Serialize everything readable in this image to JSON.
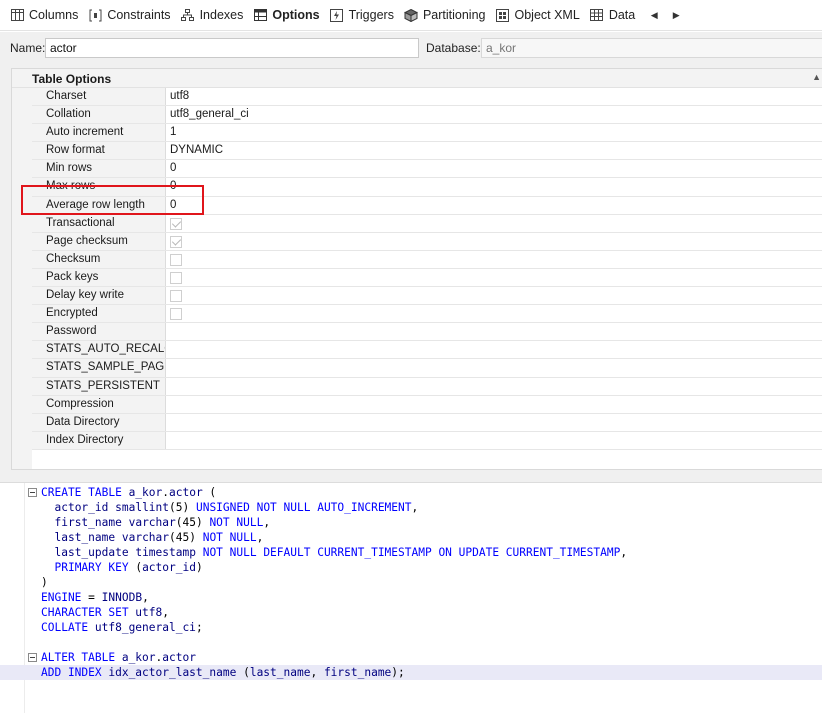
{
  "tabs": [
    {
      "label": "Columns",
      "icon": "columns-icon",
      "active": false
    },
    {
      "label": "Constraints",
      "icon": "constraints-icon",
      "active": false
    },
    {
      "label": "Indexes",
      "icon": "indexes-icon",
      "active": false
    },
    {
      "label": "Options",
      "icon": "options-icon",
      "active": true
    },
    {
      "label": "Triggers",
      "icon": "triggers-icon",
      "active": false
    },
    {
      "label": "Partitioning",
      "icon": "partitioning-icon",
      "active": false
    },
    {
      "label": "Object XML",
      "icon": "object-xml-icon",
      "active": false
    },
    {
      "label": "Data",
      "icon": "data-icon",
      "active": false
    }
  ],
  "nav": {
    "prev": "◀",
    "next": "▶"
  },
  "name_row": {
    "name_label": "Name:",
    "name_value": "actor",
    "database_label": "Database:",
    "database_placeholder": "a_kor"
  },
  "options": {
    "title": "Table Options",
    "collapse_glyph": "▲",
    "rows": [
      {
        "key": "Charset",
        "value": "utf8"
      },
      {
        "key": "Collation",
        "value": "utf8_general_ci"
      },
      {
        "key": "Auto increment",
        "value": "1"
      },
      {
        "key": "Row format",
        "value": "DYNAMIC"
      },
      {
        "key": "Min rows",
        "value": "0"
      },
      {
        "key": "Max rows",
        "value": "0"
      },
      {
        "key": "Average row length",
        "value": "0"
      },
      {
        "key": "Transactional",
        "checkbox": true,
        "checked": true
      },
      {
        "key": "Page checksum",
        "checkbox": true,
        "checked": true
      },
      {
        "key": "Checksum",
        "checkbox": true,
        "checked": false
      },
      {
        "key": "Pack keys",
        "checkbox": true,
        "checked": false
      },
      {
        "key": "Delay key write",
        "checkbox": true,
        "checked": false
      },
      {
        "key": "Encrypted",
        "checkbox": true,
        "checked": false
      },
      {
        "key": "Password",
        "value": ""
      },
      {
        "key": "STATS_AUTO_RECALC",
        "value": ""
      },
      {
        "key": "STATS_SAMPLE_PAGES",
        "value": ""
      },
      {
        "key": "STATS_PERSISTENT",
        "value": ""
      },
      {
        "key": "Compression",
        "value": ""
      },
      {
        "key": "Data Directory",
        "value": ""
      },
      {
        "key": "Index Directory",
        "value": ""
      }
    ]
  },
  "sql": [
    {
      "fold": true,
      "tokens": [
        [
          "kw",
          "CREATE TABLE "
        ],
        [
          "nm",
          "a_kor"
        ],
        [
          "pl",
          "."
        ],
        [
          "nm",
          "actor"
        ],
        [
          "pl",
          " ("
        ]
      ]
    },
    {
      "tokens": [
        [
          "pl",
          "  "
        ],
        [
          "nm",
          "actor_id"
        ],
        [
          "pl",
          " "
        ],
        [
          "ty",
          "smallint"
        ],
        [
          "pl",
          "(5) "
        ],
        [
          "kw",
          "UNSIGNED NOT NULL AUTO_INCREMENT"
        ],
        [
          "pl",
          ","
        ]
      ]
    },
    {
      "tokens": [
        [
          "pl",
          "  "
        ],
        [
          "nm",
          "first_name"
        ],
        [
          "pl",
          " "
        ],
        [
          "ty",
          "varchar"
        ],
        [
          "pl",
          "(45) "
        ],
        [
          "kw",
          "NOT NULL"
        ],
        [
          "pl",
          ","
        ]
      ]
    },
    {
      "tokens": [
        [
          "pl",
          "  "
        ],
        [
          "nm",
          "last_name"
        ],
        [
          "pl",
          " "
        ],
        [
          "ty",
          "varchar"
        ],
        [
          "pl",
          "(45) "
        ],
        [
          "kw",
          "NOT NULL"
        ],
        [
          "pl",
          ","
        ]
      ]
    },
    {
      "tokens": [
        [
          "pl",
          "  "
        ],
        [
          "nm",
          "last_update"
        ],
        [
          "pl",
          " "
        ],
        [
          "ty",
          "timestamp"
        ],
        [
          "pl",
          " "
        ],
        [
          "kw",
          "NOT NULL DEFAULT CURRENT_TIMESTAMP ON UPDATE CURRENT_TIMESTAMP"
        ],
        [
          "pl",
          ","
        ]
      ]
    },
    {
      "tokens": [
        [
          "pl",
          "  "
        ],
        [
          "kw",
          "PRIMARY KEY"
        ],
        [
          "pl",
          " ("
        ],
        [
          "nm",
          "actor_id"
        ],
        [
          "pl",
          ")"
        ]
      ]
    },
    {
      "tokens": [
        [
          "pl",
          ")"
        ]
      ]
    },
    {
      "tokens": [
        [
          "kw",
          "ENGINE"
        ],
        [
          "pl",
          " = "
        ],
        [
          "nm",
          "INNODB"
        ],
        [
          "pl",
          ","
        ]
      ]
    },
    {
      "tokens": [
        [
          "kw",
          "CHARACTER SET "
        ],
        [
          "nm",
          "utf8"
        ],
        [
          "pl",
          ","
        ]
      ]
    },
    {
      "tokens": [
        [
          "kw",
          "COLLATE "
        ],
        [
          "nm",
          "utf8_general_ci"
        ],
        [
          "pl",
          ";"
        ]
      ]
    },
    {
      "tokens": [
        [
          "pl",
          ""
        ]
      ]
    },
    {
      "fold": true,
      "tokens": [
        [
          "kw",
          "ALTER TABLE "
        ],
        [
          "nm",
          "a_kor"
        ],
        [
          "pl",
          "."
        ],
        [
          "nm",
          "actor"
        ]
      ]
    },
    {
      "current": true,
      "tokens": [
        [
          "kw",
          "ADD INDEX "
        ],
        [
          "nm",
          "idx_actor_last_name"
        ],
        [
          "pl",
          " ("
        ],
        [
          "nm",
          "last_name"
        ],
        [
          "pl",
          ", "
        ],
        [
          "nm",
          "first_name"
        ],
        [
          "pl",
          ");"
        ]
      ]
    }
  ]
}
